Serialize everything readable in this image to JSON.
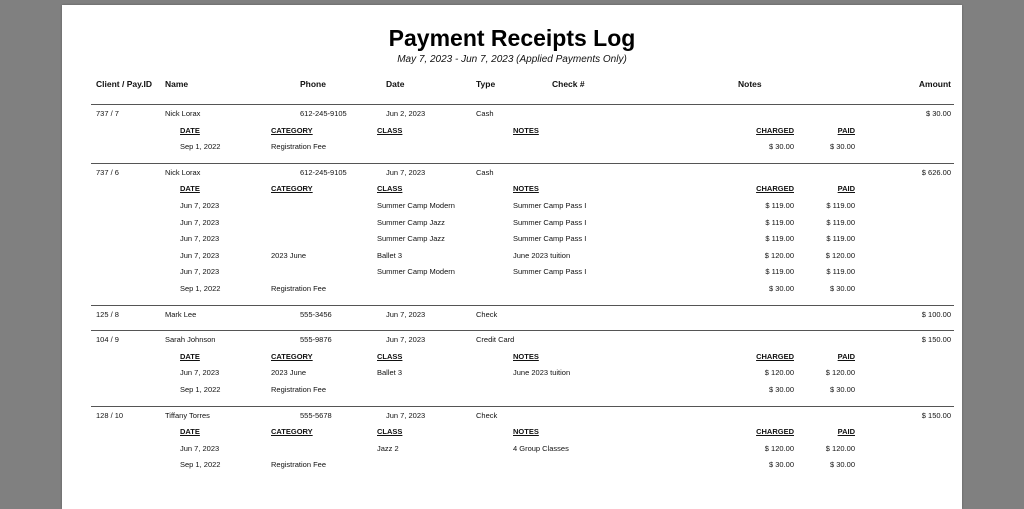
{
  "report": {
    "title": "Payment Receipts Log",
    "subtitle": "May 7, 2023 - Jun 7, 2023 (Applied Payments Only)"
  },
  "columns": {
    "client": "Client / Pay.ID",
    "name": "Name",
    "phone": "Phone",
    "date": "Date",
    "type": "Type",
    "check": "Check #",
    "notes": "Notes",
    "amount": "Amount"
  },
  "sub_columns": {
    "date": "DATE",
    "category": "CATEGORY",
    "class": "CLASS",
    "notes": "NOTES",
    "charged": "CHARGED",
    "paid": "PAID"
  },
  "payments": [
    {
      "client": "737 / 7",
      "name": "Nick Lorax",
      "phone": "612-245-9105",
      "date": "Jun 2, 2023",
      "type": "Cash",
      "amount": "$ 30.00",
      "details": [
        {
          "date": "Sep 1, 2022",
          "category": "Registration Fee",
          "class": "",
          "notes": "",
          "charged": "$ 30.00",
          "paid": "$ 30.00"
        }
      ]
    },
    {
      "client": "737 / 6",
      "name": "Nick Lorax",
      "phone": "612-245-9105",
      "date": "Jun 7, 2023",
      "type": "Cash",
      "amount": "$ 626.00",
      "details": [
        {
          "date": "Jun 7, 2023",
          "category": "",
          "class": "Summer Camp Modern",
          "notes": "Summer Camp Pass I",
          "charged": "$ 119.00",
          "paid": "$ 119.00"
        },
        {
          "date": "Jun 7, 2023",
          "category": "",
          "class": "Summer Camp Jazz",
          "notes": "Summer Camp Pass I",
          "charged": "$ 119.00",
          "paid": "$ 119.00"
        },
        {
          "date": "Jun 7, 2023",
          "category": "",
          "class": "Summer Camp Jazz",
          "notes": "Summer Camp Pass I",
          "charged": "$ 119.00",
          "paid": "$ 119.00"
        },
        {
          "date": "Jun 7, 2023",
          "category": "2023 June",
          "class": "Ballet 3",
          "notes": "June 2023 tuition",
          "charged": "$ 120.00",
          "paid": "$ 120.00"
        },
        {
          "date": "Jun 7, 2023",
          "category": "",
          "class": "Summer Camp Modern",
          "notes": "Summer Camp Pass I",
          "charged": "$ 119.00",
          "paid": "$ 119.00"
        },
        {
          "date": "Sep 1, 2022",
          "category": "Registration Fee",
          "class": "",
          "notes": "",
          "charged": "$ 30.00",
          "paid": "$ 30.00"
        }
      ]
    },
    {
      "client": "125 / 8",
      "name": "Mark Lee",
      "phone": "555-3456",
      "date": "Jun 7, 2023",
      "type": "Check",
      "amount": "$ 100.00",
      "details": []
    },
    {
      "client": "104 / 9",
      "name": "Sarah Johnson",
      "phone": "555-9876",
      "date": "Jun 7, 2023",
      "type": "Credit Card",
      "amount": "$ 150.00",
      "details": [
        {
          "date": "Jun 7, 2023",
          "category": "2023 June",
          "class": "Ballet 3",
          "notes": "June 2023 tuition",
          "charged": "$ 120.00",
          "paid": "$ 120.00"
        },
        {
          "date": "Sep 1, 2022",
          "category": "Registration Fee",
          "class": "",
          "notes": "",
          "charged": "$ 30.00",
          "paid": "$ 30.00"
        }
      ]
    },
    {
      "client": "128 / 10",
      "name": "Tiffany Torres",
      "phone": "555-5678",
      "date": "Jun 7, 2023",
      "type": "Check",
      "amount": "$ 150.00",
      "details": [
        {
          "date": "Jun 7, 2023",
          "category": "",
          "class": "Jazz 2",
          "notes": "4 Group Classes",
          "charged": "$ 120.00",
          "paid": "$ 120.00"
        },
        {
          "date": "Sep 1, 2022",
          "category": "Registration Fee",
          "class": "",
          "notes": "",
          "charged": "$ 30.00",
          "paid": "$ 30.00"
        }
      ]
    }
  ]
}
